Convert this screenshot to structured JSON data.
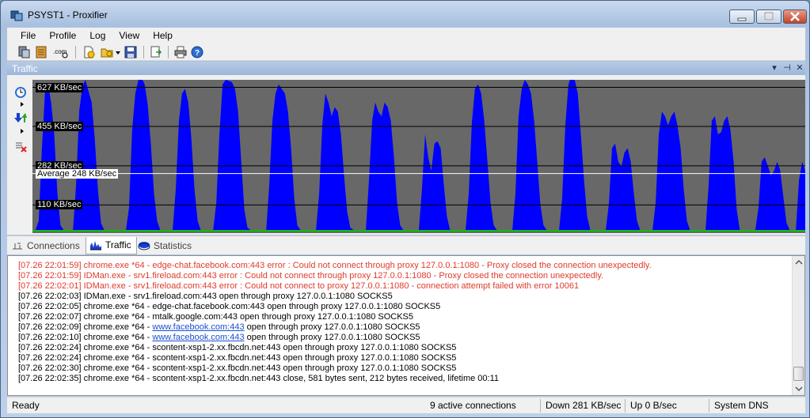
{
  "window": {
    "title": "PSYST1 - Proxifier"
  },
  "menu": [
    "File",
    "Profile",
    "Log",
    "View",
    "Help"
  ],
  "toolbar_icons": [
    "proxy-servers-icon",
    "proxification-rules-icon",
    "name-resolution-icon",
    "new-profile-icon",
    "open-profile-icon",
    "save-profile-icon",
    "export-icon",
    "print-icon",
    "help-icon"
  ],
  "traffic_pane": {
    "title": "Traffic",
    "labels": [
      "627 KB/sec",
      "455 KB/sec",
      "282 KB/sec",
      "110 KB/sec"
    ],
    "average_label": "Average 248 KB/sec",
    "colors": {
      "fill": "#0000ff",
      "background": "#686868",
      "baseline": "#00c000"
    }
  },
  "chart_data": {
    "type": "area",
    "title": "",
    "ylabel": "",
    "unit": "KB/sec",
    "gridlines": [
      627,
      455,
      282,
      110
    ],
    "average": 248,
    "ylim": [
      0,
      660
    ],
    "samples_note": "",
    "values": [
      0,
      0,
      40,
      350,
      600,
      640,
      560,
      420,
      160,
      20,
      0,
      0,
      0,
      0,
      200,
      520,
      630,
      660,
      610,
      560,
      400,
      180,
      30,
      0,
      0,
      0,
      0,
      0,
      0,
      0,
      0,
      100,
      440,
      600,
      660,
      670,
      640,
      550,
      380,
      160,
      40,
      0,
      0,
      0,
      0,
      0,
      180,
      480,
      600,
      620,
      560,
      400,
      180,
      40,
      0,
      0,
      0,
      0,
      0,
      120,
      420,
      640,
      660,
      655,
      650,
      620,
      520,
      300,
      90,
      10,
      0,
      0,
      0,
      0,
      0,
      0,
      200,
      480,
      600,
      640,
      620,
      600,
      520,
      360,
      140,
      20,
      0,
      0,
      0,
      0,
      0,
      0,
      160,
      460,
      600,
      560,
      500,
      540,
      520,
      420,
      240,
      80,
      10,
      0,
      0,
      0,
      0,
      0,
      220,
      480,
      560,
      520,
      500,
      560,
      540,
      480,
      320,
      120,
      20,
      0,
      0,
      0,
      0,
      0,
      0,
      180,
      420,
      320,
      260,
      380,
      390,
      360,
      200,
      60,
      0,
      0,
      0,
      0,
      0,
      0,
      160,
      470,
      620,
      640,
      600,
      480,
      300,
      120,
      20,
      0,
      0,
      0,
      0,
      0,
      0,
      160,
      500,
      620,
      660,
      640,
      600,
      480,
      300,
      110,
      20,
      0,
      0,
      0,
      0,
      0,
      140,
      460,
      640,
      680,
      660,
      600,
      420,
      220,
      60,
      0,
      0,
      0,
      0,
      0,
      0,
      120,
      360,
      380,
      300,
      280,
      340,
      360,
      300,
      160,
      40,
      0,
      0,
      0,
      0,
      0,
      120,
      420,
      520,
      500,
      460,
      500,
      520,
      460,
      360,
      180,
      40,
      0,
      0,
      0,
      0,
      0,
      0,
      200,
      480,
      500,
      420,
      430,
      480,
      500,
      440,
      300,
      90,
      0,
      0,
      0,
      0,
      0,
      0,
      100,
      300,
      320,
      280,
      240,
      260,
      300,
      260,
      140,
      30,
      0,
      0,
      0,
      220,
      300,
      260
    ]
  },
  "tabs": [
    {
      "label": "Connections",
      "icon": "connections-icon",
      "active": false
    },
    {
      "label": "Traffic",
      "icon": "traffic-icon",
      "active": true
    },
    {
      "label": "Statistics",
      "icon": "statistics-icon",
      "active": false
    }
  ],
  "log": [
    {
      "type": "error",
      "text": "[07.26 22:01:59] chrome.exe *64 - edge-chat.facebook.com:443 error : Could not connect through proxy 127.0.0.1:1080 - Proxy closed the connection unexpectedly."
    },
    {
      "type": "error",
      "text": "[07.26 22:01:59] IDMan.exe - srv1.fireload.com:443 error : Could not connect through proxy 127.0.0.1:1080 - Proxy closed the connection unexpectedly."
    },
    {
      "type": "error",
      "text": "[07.26 22:02:01] IDMan.exe - srv1.fireload.com:443 error : Could not connect to proxy 127.0.0.1:1080 - connection attempt failed with error 10061"
    },
    {
      "type": "info",
      "text": "[07.26 22:02:03] IDMan.exe - srv1.fireload.com:443 open through proxy 127.0.0.1:1080 SOCKS5"
    },
    {
      "type": "info",
      "text": "[07.26 22:02:05] chrome.exe *64 - edge-chat.facebook.com:443 open through proxy 127.0.0.1:1080 SOCKS5"
    },
    {
      "type": "info",
      "text": "[07.26 22:02:07] chrome.exe *64 - mtalk.google.com:443 open through proxy 127.0.0.1:1080 SOCKS5"
    },
    {
      "type": "link",
      "pre": "[07.26 22:02:09] chrome.exe *64 - ",
      "link": "www.facebook.com:443",
      "post": " open through proxy 127.0.0.1:1080 SOCKS5"
    },
    {
      "type": "link",
      "pre": "[07.26 22:02:10] chrome.exe *64 - ",
      "link": "www.facebook.com:443",
      "post": " open through proxy 127.0.0.1:1080 SOCKS5"
    },
    {
      "type": "info",
      "text": "[07.26 22:02:24] chrome.exe *64 - scontent-xsp1-2.xx.fbcdn.net:443 open through proxy 127.0.0.1:1080 SOCKS5"
    },
    {
      "type": "info",
      "text": "[07.26 22:02:24] chrome.exe *64 - scontent-xsp1-2.xx.fbcdn.net:443 open through proxy 127.0.0.1:1080 SOCKS5"
    },
    {
      "type": "info",
      "text": "[07.26 22:02:30] chrome.exe *64 - scontent-xsp1-2.xx.fbcdn.net:443 open through proxy 127.0.0.1:1080 SOCKS5"
    },
    {
      "type": "info",
      "text": "[07.26 22:02:35] chrome.exe *64 - scontent-xsp1-2.xx.fbcdn.net:443 close, 581 bytes sent, 212 bytes received, lifetime 00:11"
    }
  ],
  "status": {
    "ready": "Ready",
    "connections": "9 active connections",
    "down": "Down 281 KB/sec",
    "up": "Up 0 B/sec",
    "dns": "System DNS"
  }
}
